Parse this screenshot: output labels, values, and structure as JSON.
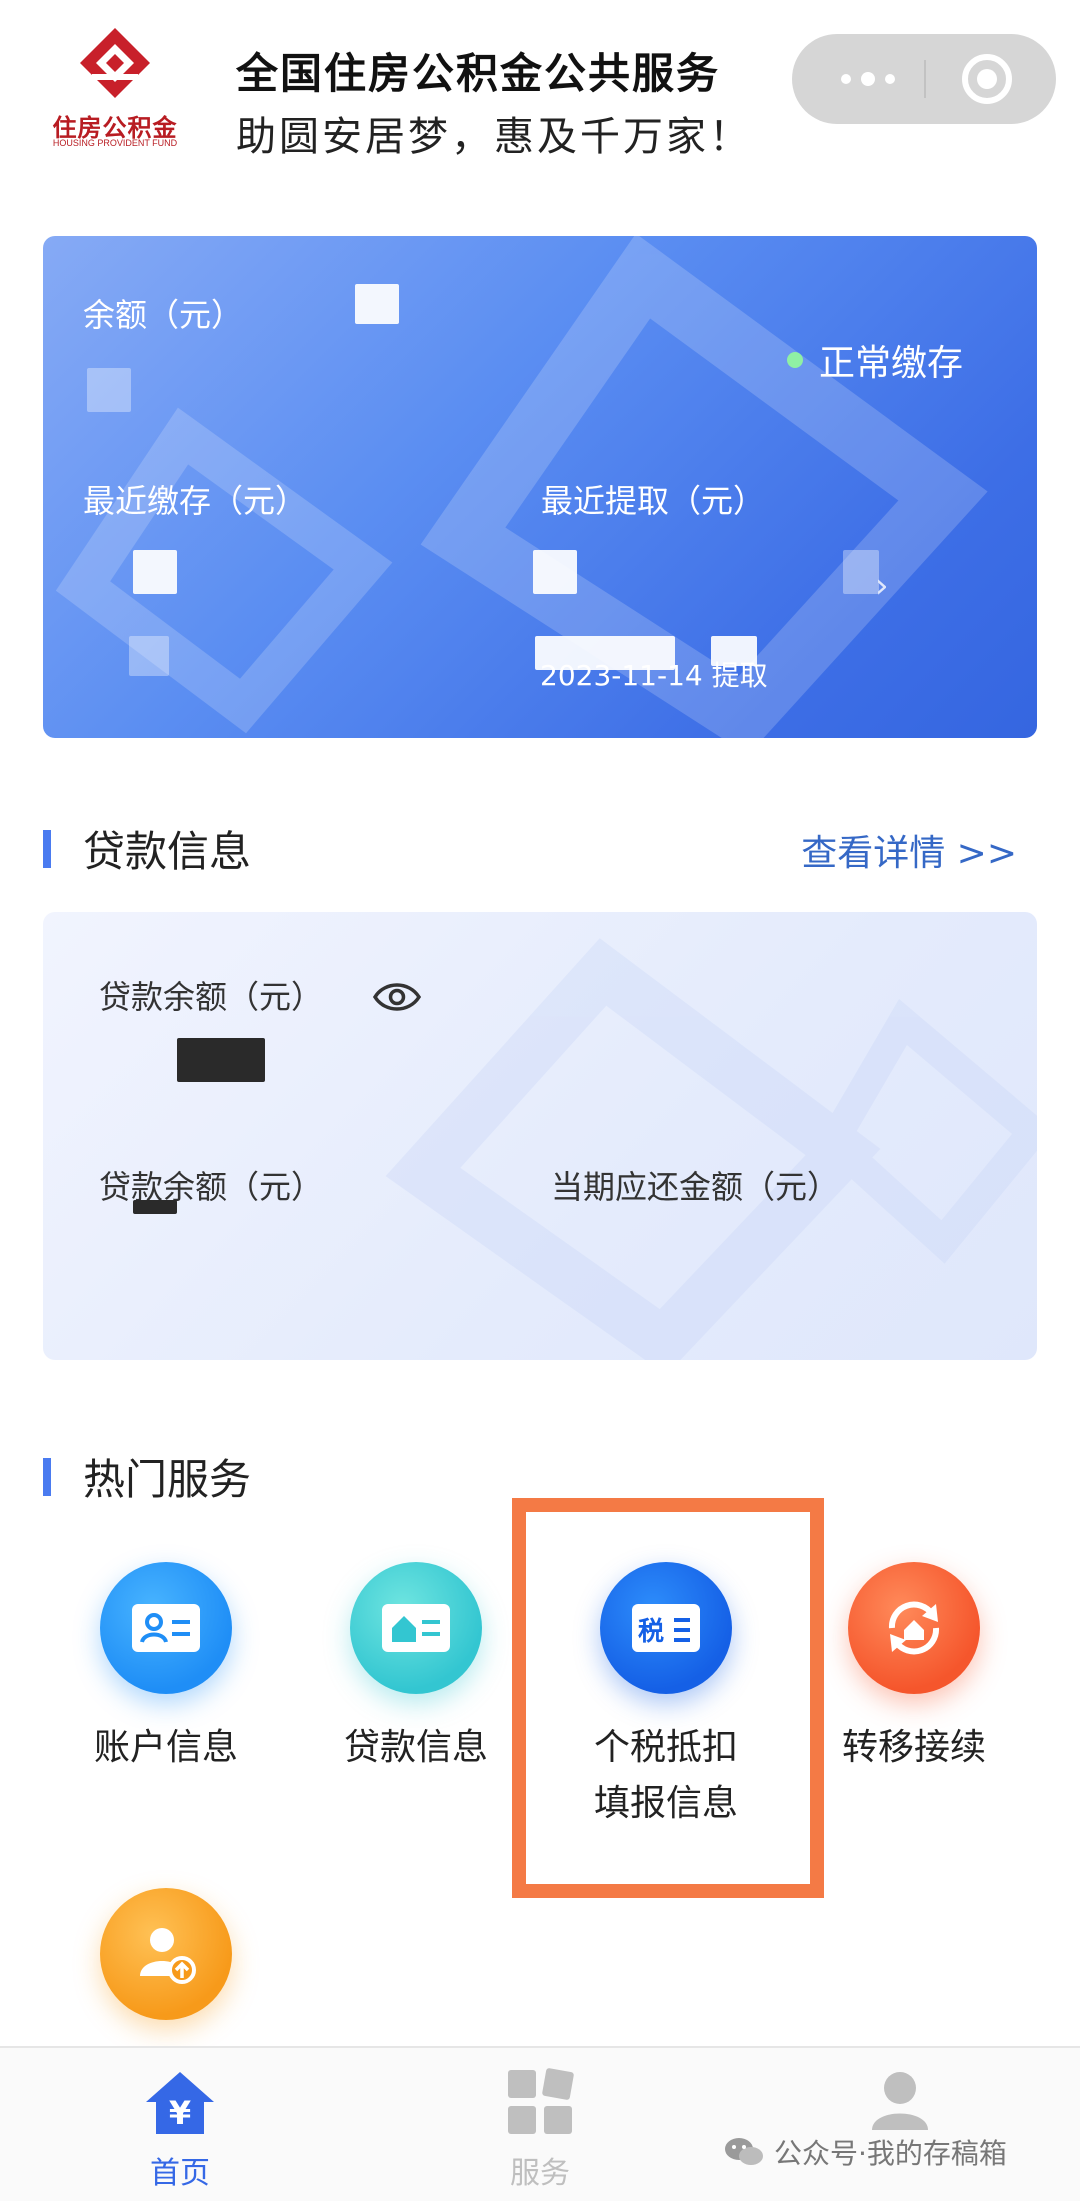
{
  "header": {
    "logo_text": "住房公积金",
    "logo_en": "HOUSING PROVIDENT FUND",
    "title": "全国住房公积金公共服务",
    "slogan": "助圆安居梦，惠及千万家！",
    "capsule_icons": [
      "more-dots-icon",
      "close-target-icon"
    ]
  },
  "balance_card": {
    "balance_label": "余额（元）",
    "status": "正常缴存",
    "status_color": "#8ff0a4",
    "recent_deposit_label": "最近缴存（元）",
    "recent_withdraw_label": "最近提取（元）",
    "withdraw_date": "2023-11-14 提取"
  },
  "loan_section": {
    "title": "贷款信息",
    "detail_link": "查看详情 >>",
    "loan_balance_label": "贷款余额（元）",
    "loan_balance_label_2": "贷款余额（元）",
    "current_due_label": "当期应还金额（元）"
  },
  "hot_services": {
    "title": "热门服务",
    "items": [
      {
        "label": "账户信息",
        "icon": "account-card-icon",
        "color": "#1f8ef6"
      },
      {
        "label": "贷款信息",
        "icon": "loan-house-icon",
        "color": "#33c6d1"
      },
      {
        "label": "个税抵扣\n填报信息",
        "icon": "tax-card-icon",
        "color": "#1560e6"
      },
      {
        "label": "转移接续",
        "icon": "transfer-cycle-icon",
        "color": "#f5562c"
      },
      {
        "label": "",
        "icon": "user-upload-icon",
        "color": "#f79a1a"
      }
    ],
    "highlight_color": "#f47a45"
  },
  "tabbar": {
    "tabs": [
      {
        "label": "首页",
        "icon": "home-yen-icon",
        "active": true
      },
      {
        "label": "服务",
        "icon": "grid-services-icon",
        "active": false
      },
      {
        "label": "",
        "icon": "profile-icon",
        "active": false
      }
    ],
    "active_color": "#3568e6",
    "inactive_color": "#bfbfbf"
  },
  "watermark": {
    "text": "公众号·我的存稿箱",
    "icon": "wechat-icon"
  }
}
